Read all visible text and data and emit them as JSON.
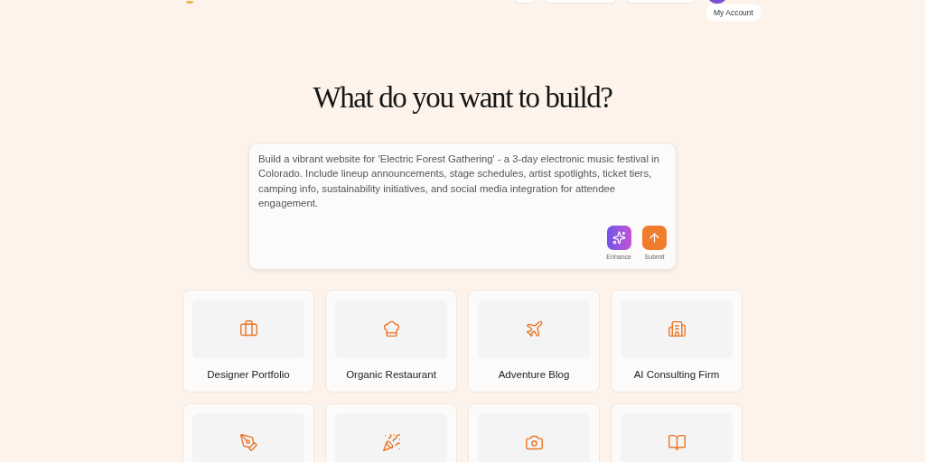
{
  "header": {
    "tooltip": "My Account"
  },
  "title": "What do you want to build?",
  "prompt": {
    "value": "Build a vibrant website for 'Electric Forest Gathering' - a 3-day electronic music festival in Colorado. Include lineup announcements, stage schedules, artist spotlights, ticket tiers, camping info, sustainability initiatives, and social media integration for attendee engagement.",
    "actions": [
      {
        "kind": "enhance",
        "label": "Enhance"
      },
      {
        "kind": "submit",
        "label": "Submit"
      }
    ]
  },
  "templates": [
    {
      "label": "Designer Portfolio"
    },
    {
      "label": "Organic Restaurant"
    },
    {
      "label": "Adventure Blog"
    },
    {
      "label": "AI Consulting Firm"
    }
  ]
}
